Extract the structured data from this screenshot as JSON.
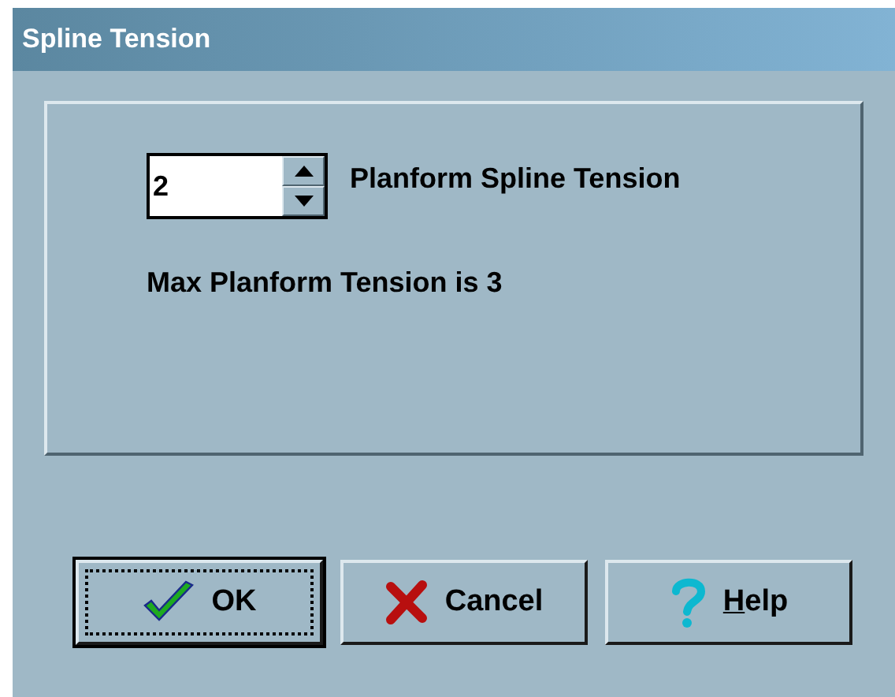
{
  "window": {
    "title": "Spline Tension"
  },
  "spin": {
    "value": "2",
    "label": "Planform Spline Tension"
  },
  "note": "Max Planform Tension is 3",
  "buttons": [
    {
      "kind": "ok",
      "label": "OK",
      "focused": true,
      "underline_first": false
    },
    {
      "kind": "cancel",
      "label": "Cancel",
      "focused": false,
      "underline_first": false
    },
    {
      "kind": "help",
      "label": "Help",
      "focused": false,
      "underline_first": true
    }
  ]
}
